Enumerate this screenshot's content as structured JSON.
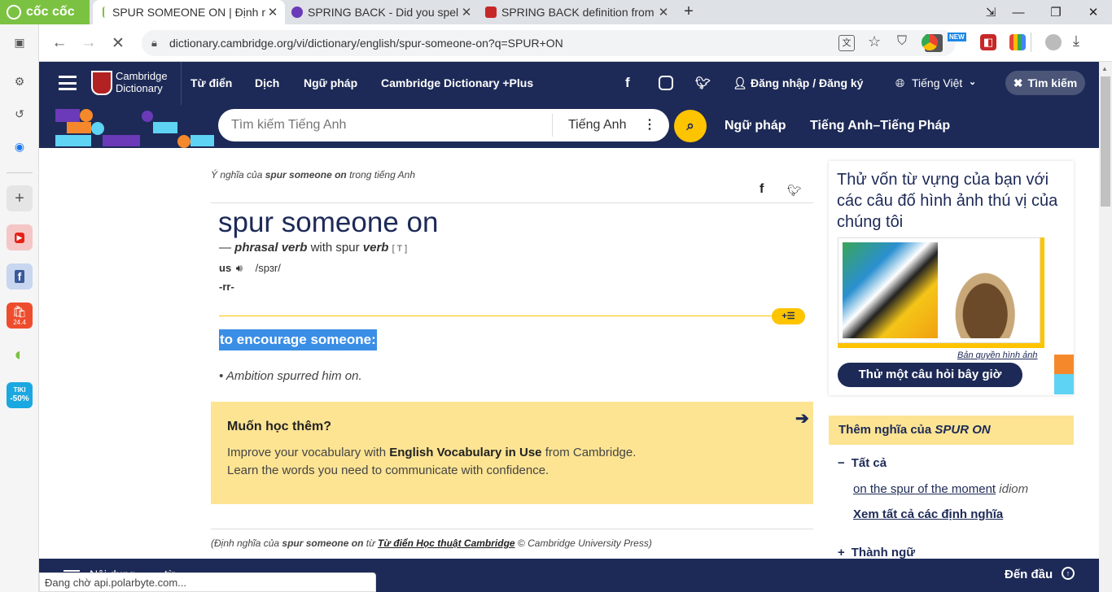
{
  "browser": {
    "tabs": [
      {
        "title": "SPUR SOMEONE ON | Định nghĩa",
        "color": "#f1f3f4",
        "active": true
      },
      {
        "title": "SPRING BACK - Did you spell",
        "color": "#6a3ab8",
        "active": false
      },
      {
        "title": "SPRING BACK definition from",
        "color": "#c62828",
        "active": false
      }
    ],
    "coccoc_label": "cốc cốc",
    "url": "dictionary.cambridge.org/vi/dictionary/english/spur-someone-on?q=SPUR+ON",
    "status_text": "Đang chờ api.polarbyte.com...",
    "new_badge": "NEW"
  },
  "sidebar": {
    "shopee_badge": "24.4",
    "tiki_label": "TIKI",
    "tiki_badge": "-50%"
  },
  "header": {
    "logo_line1": "Cambridge",
    "logo_line2": "Dictionary",
    "nav": [
      "Từ điển",
      "Dịch",
      "Ngữ pháp",
      "Cambridge Dictionary +Plus"
    ],
    "login": "Đăng nhập / Đăng ký",
    "language": "Tiếng Việt",
    "search_button": "Tìm kiếm",
    "search_placeholder": "Tìm kiếm Tiếng Anh",
    "search_lang": "Tiếng Anh",
    "subnav": [
      "Ngữ pháp",
      "Tiếng Anh–Tiếng Pháp"
    ]
  },
  "entry": {
    "meaning_prefix": "Ý nghĩa của ",
    "meaning_word": "spur someone on",
    "meaning_suffix": " trong tiếng Anh",
    "headword": "spur someone on",
    "dash": "—",
    "pos": "phrasal verb",
    "with_text": "with spur",
    "verb": "verb",
    "grammar": "[ T ]",
    "region": "us",
    "pron": "/spɜr/",
    "inflection": "-rr-",
    "definition": "to encourage someone:",
    "example": "Ambition spurred him on.",
    "more_title": "Muốn học thêm?",
    "more_line1_pre": "Improve your vocabulary with ",
    "more_line1_bold": "English Vocabulary in Use",
    "more_line1_post": " from Cambridge.",
    "more_line2": "Learn the words you need to communicate with confidence.",
    "source_pre": "(Định nghĩa của ",
    "source_word": "spur someone on",
    "source_mid": " từ ",
    "source_link": "Từ điển Học thuật Cambridge",
    "source_post": " © Cambridge University Press)"
  },
  "right": {
    "quiz_title": "Thử vốn từ vựng của bạn với các câu đố hình ảnh thú vị của chúng tôi",
    "copyright": "Bản quyền hình ảnh",
    "quiz_button": "Thử một câu hỏi bây giờ",
    "more_prefix": "Thêm nghĩa của ",
    "more_word": "SPUR ON",
    "all": "Tất cả",
    "idiom_link": "on the spur of the moment",
    "idiom_tag": "idiom",
    "see_all": "Xem tất cả các định nghĩa",
    "idioms_section": "Thành ngữ"
  },
  "footer": {
    "left_text": "Nội dung",
    "left_text2": "từ",
    "top": "Đến đầu"
  }
}
